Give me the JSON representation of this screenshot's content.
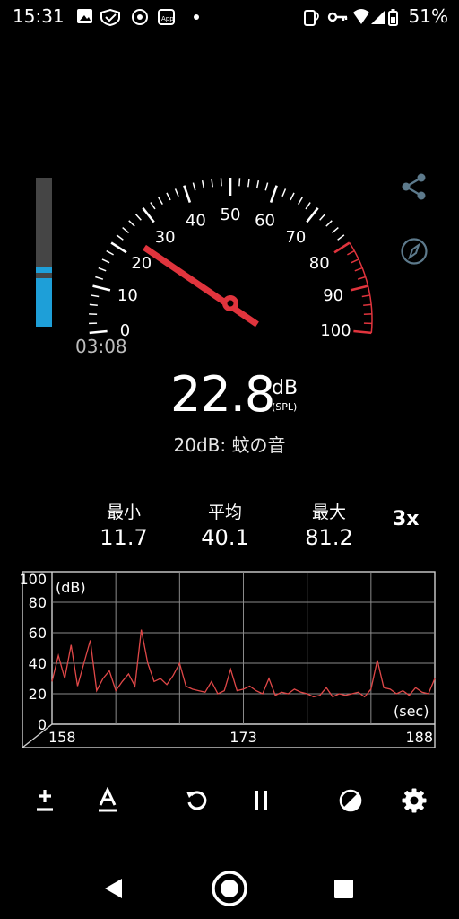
{
  "status_bar": {
    "time": "15:31",
    "battery": "51%"
  },
  "gauge": {
    "scale_labels": [
      "0",
      "10",
      "20",
      "30",
      "40",
      "50",
      "60",
      "70",
      "80",
      "90",
      "100"
    ],
    "needle_value": 22.8,
    "red_zone_start": 80,
    "elapsed_time": "03:08"
  },
  "level_meter": {
    "fill_level_fraction": 0.36,
    "peak_fraction": 0.36
  },
  "reading": {
    "value": "22.8",
    "unit": "dB",
    "unit_sub": "(SPL)"
  },
  "reference": {
    "text": "20dB: 蚊の音"
  },
  "stats": {
    "min_label": "最小",
    "min_value": "11.7",
    "avg_label": "平均",
    "avg_value": "40.1",
    "max_label": "最大",
    "max_value": "81.2"
  },
  "speed_button": {
    "label": "3x"
  },
  "graph": {
    "y_unit_label": "(dB)",
    "x_unit_label": "(sec)",
    "y_ticks": [
      "100",
      "80",
      "60",
      "40",
      "20",
      "0"
    ],
    "x_ticks": [
      "158",
      "173",
      "188"
    ],
    "line_color": "#e04848"
  },
  "chart_data": {
    "type": "line",
    "ylabel": "(dB)",
    "xlabel": "(sec)",
    "xlim": [
      158,
      188
    ],
    "ylim": [
      0,
      100
    ],
    "series": [
      {
        "x": [
          158,
          158.5,
          159,
          159.5,
          160,
          160.5,
          161,
          161.5,
          162,
          162.5,
          163,
          163.5,
          164,
          164.5,
          165,
          165.5,
          166,
          166.5,
          167,
          167.5,
          168,
          168.5,
          169,
          169.5,
          170,
          170.5,
          171,
          171.5,
          172,
          172.5,
          173,
          173.5,
          174,
          174.5,
          175,
          175.5,
          176,
          176.5,
          177,
          177.5,
          178,
          178.5,
          179,
          179.5,
          180,
          180.5,
          181,
          181.5,
          182,
          182.5,
          183,
          183.5,
          184,
          184.5,
          185,
          185.5,
          186,
          186.5,
          187,
          187.5,
          188
        ],
        "y": [
          28,
          45,
          30,
          52,
          25,
          40,
          55,
          22,
          30,
          35,
          22,
          28,
          33,
          25,
          62,
          40,
          28,
          30,
          26,
          32,
          40,
          25,
          23,
          22,
          21,
          28,
          20,
          22,
          36,
          22,
          23,
          25,
          22,
          20,
          30,
          19,
          21,
          20,
          23,
          21,
          20,
          18,
          19,
          24,
          18,
          20,
          19,
          20,
          21,
          18,
          23,
          42,
          24,
          23,
          20,
          22,
          19,
          24,
          21,
          20,
          30
        ]
      }
    ]
  },
  "toolbar": {
    "items": [
      {
        "name": "calibrate",
        "icon": "plus-minus-icon"
      },
      {
        "name": "weighting",
        "icon": "a-weighting-icon"
      },
      {
        "name": "reset",
        "icon": "reset-icon"
      },
      {
        "name": "pause",
        "icon": "pause-icon"
      },
      {
        "name": "theme",
        "icon": "contrast-icon"
      },
      {
        "name": "settings",
        "icon": "gear-icon"
      }
    ]
  }
}
